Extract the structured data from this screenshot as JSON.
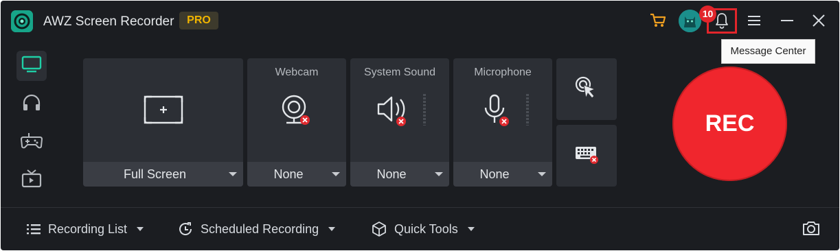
{
  "app": {
    "title": "AWZ Screen Recorder",
    "badge": "PRO",
    "logo_icon": "recorder-logo-icon"
  },
  "titlebar": {
    "cart_icon": "cart-icon",
    "avatar_icon": "avatar-icon",
    "notification_count": "10",
    "bell_icon": "bell-icon",
    "tooltip": "Message Center",
    "menu_icon": "menu-icon",
    "minimize_icon": "minimize-icon",
    "close_icon": "close-icon"
  },
  "sidebar": {
    "items": [
      {
        "name": "screen-mode",
        "icon": "monitor-icon",
        "active": true
      },
      {
        "name": "audio-mode",
        "icon": "headphones-icon",
        "active": false
      },
      {
        "name": "game-mode",
        "icon": "gamepad-icon",
        "active": false
      },
      {
        "name": "tv-mode",
        "icon": "tv-icon",
        "active": false
      }
    ]
  },
  "panels": {
    "screen": {
      "value": "Full Screen"
    },
    "webcam": {
      "label": "Webcam",
      "value": "None"
    },
    "system_sound": {
      "label": "System Sound",
      "value": "None"
    },
    "microphone": {
      "label": "Microphone",
      "value": "None"
    }
  },
  "tools": {
    "cursor_icon": "cursor-click-icon",
    "keyboard_icon": "keyboard-disabled-icon"
  },
  "rec_button": "REC",
  "bottom_bar": {
    "recording_list": "Recording List",
    "scheduled_recording": "Scheduled Recording",
    "quick_tools": "Quick Tools",
    "screenshot_icon": "camera-icon"
  },
  "colors": {
    "background": "#1b1d21",
    "panel": "#2c2f35",
    "accent": "#1fcfa6",
    "rec": "#f0262d",
    "pro": "#f0b400",
    "alert": "#e2252b"
  }
}
